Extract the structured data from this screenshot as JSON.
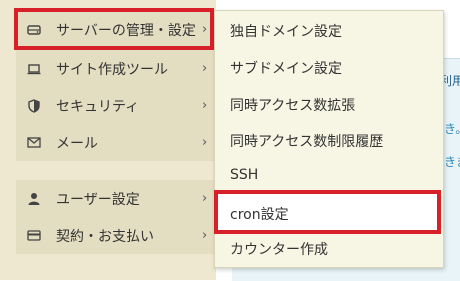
{
  "background": {
    "title_fragment": "利用",
    "line1_fragment": "き。",
    "line2_fragment": "きま"
  },
  "sidebar": {
    "items": [
      {
        "label": "サーバーの管理・設定",
        "icon": "server-icon",
        "chevron": "›"
      },
      {
        "label": "サイト作成ツール",
        "icon": "laptop-icon",
        "chevron": "›"
      },
      {
        "label": "セキュリティ",
        "icon": "shield-icon",
        "chevron": "›"
      },
      {
        "label": "メール",
        "icon": "mail-icon",
        "chevron": "›"
      },
      {
        "label": "ユーザー設定",
        "icon": "user-icon",
        "chevron": "›"
      },
      {
        "label": "契約・お支払い",
        "icon": "credit-card-icon",
        "chevron": "›"
      }
    ]
  },
  "dropdown": {
    "items": [
      {
        "label": "独自ドメイン設定"
      },
      {
        "label": "サブドメイン設定"
      },
      {
        "label": "同時アクセス数拡張"
      },
      {
        "label": "同時アクセス数制限履歴"
      },
      {
        "label": "SSH"
      },
      {
        "label": "cron設定"
      },
      {
        "label": "カウンター作成"
      }
    ]
  },
  "colors": {
    "highlight": "#d8202a",
    "sidebar_bg": "#e3ddc1",
    "dropdown_bg": "#f7f6e4"
  }
}
